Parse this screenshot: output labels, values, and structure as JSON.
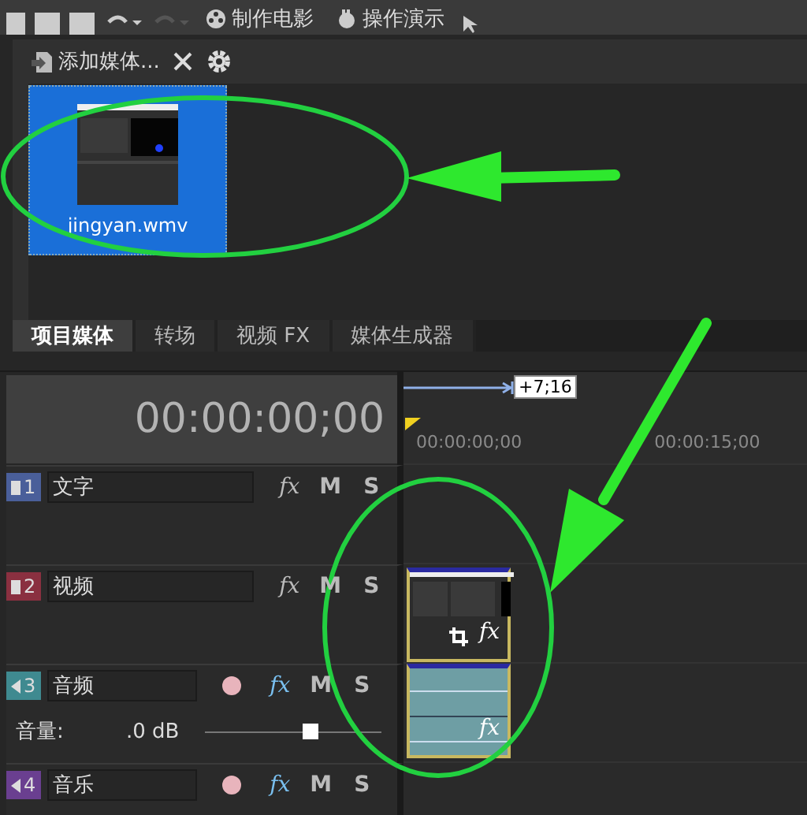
{
  "toolbar": {
    "buttons": [
      {
        "label": "制作电影"
      },
      {
        "label": "操作演示"
      }
    ]
  },
  "media_panel": {
    "add_button": "添加媒体...",
    "items": [
      {
        "name": "jingyan.wmv",
        "selected": true
      }
    ],
    "tabs": [
      {
        "label": "项目媒体",
        "selected": true
      },
      {
        "label": "转场",
        "selected": false
      },
      {
        "label": "视频 FX",
        "selected": false
      },
      {
        "label": "媒体生成器",
        "selected": false
      }
    ]
  },
  "timeline": {
    "timecode": "00:00:00;00",
    "loop_length": "+7;16",
    "ruler_labels": [
      "00:00:00;00",
      "00:00:15;00"
    ],
    "tracks": [
      {
        "kind": "video",
        "number": "1",
        "name": "文字",
        "color": "#4a5f9a",
        "controls": [
          "fx",
          "M",
          "S"
        ]
      },
      {
        "kind": "video",
        "number": "2",
        "name": "视频",
        "color": "#8a3040",
        "controls": [
          "fx",
          "M",
          "S"
        ],
        "clip": {
          "fx_label": "fx"
        }
      },
      {
        "kind": "audio",
        "number": "3",
        "name": "音频",
        "color": "#3f8a90",
        "controls": [
          "fx",
          "M",
          "S"
        ],
        "volume": {
          "label": "音量:",
          "reading": ".0 dB",
          "level": 0.6
        },
        "clip": {
          "fx_label": "fx"
        }
      },
      {
        "kind": "audio",
        "number": "4",
        "name": "音乐",
        "color": "#6a3f90",
        "controls": [
          "fx",
          "M",
          "S"
        ]
      }
    ]
  }
}
